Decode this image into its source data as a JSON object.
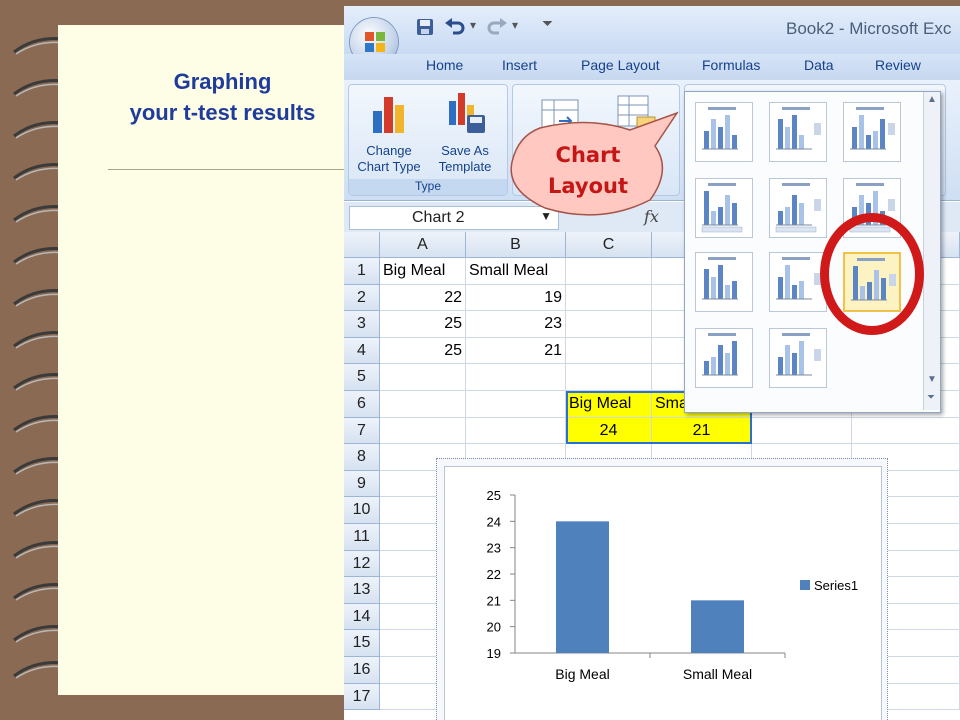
{
  "slide": {
    "title_line1": "Graphing",
    "title_line2": "your t-test results"
  },
  "excel": {
    "window_title": "Book2 - Microsoft Exc",
    "tabs": [
      "Home",
      "Insert",
      "Page Layout",
      "Formulas",
      "Data",
      "Review"
    ],
    "ribbon": {
      "change_chart_type": [
        "Change",
        "Chart Type"
      ],
      "save_as_template": [
        "Save As",
        "Template"
      ],
      "type_group": "Type"
    },
    "name_box": "Chart 2",
    "fx_label": "fx",
    "columns": [
      "A",
      "B",
      "C"
    ],
    "rows": [
      "1",
      "2",
      "3",
      "4",
      "5",
      "6",
      "7",
      "8",
      "9",
      "10",
      "11",
      "12",
      "13",
      "14",
      "15",
      "16",
      "17"
    ],
    "cells": {
      "A1": "Big Meal",
      "B1": "Small Meal",
      "A2": "22",
      "B2": "19",
      "A3": "25",
      "B3": "23",
      "A4": "25",
      "B4": "21",
      "C6": "Big Meal",
      "D6": "Small Meal",
      "C7": "24",
      "D7": "21"
    }
  },
  "callout": {
    "line1": "Chart",
    "line2": "Layout"
  },
  "colors": {
    "bar": "#4f81bd",
    "accent_red": "#d01a1a",
    "title_blue": "#1f3c9a",
    "highlight_yellow": "#ffff00"
  },
  "chart_data": {
    "type": "bar",
    "categories": [
      "Big Meal",
      "Small Meal"
    ],
    "series": [
      {
        "name": "Series1",
        "values": [
          24,
          21
        ]
      }
    ],
    "ylim": [
      19,
      25
    ],
    "yticks": [
      19,
      20,
      21,
      22,
      23,
      24,
      25
    ],
    "legend": "right",
    "grid": false
  }
}
